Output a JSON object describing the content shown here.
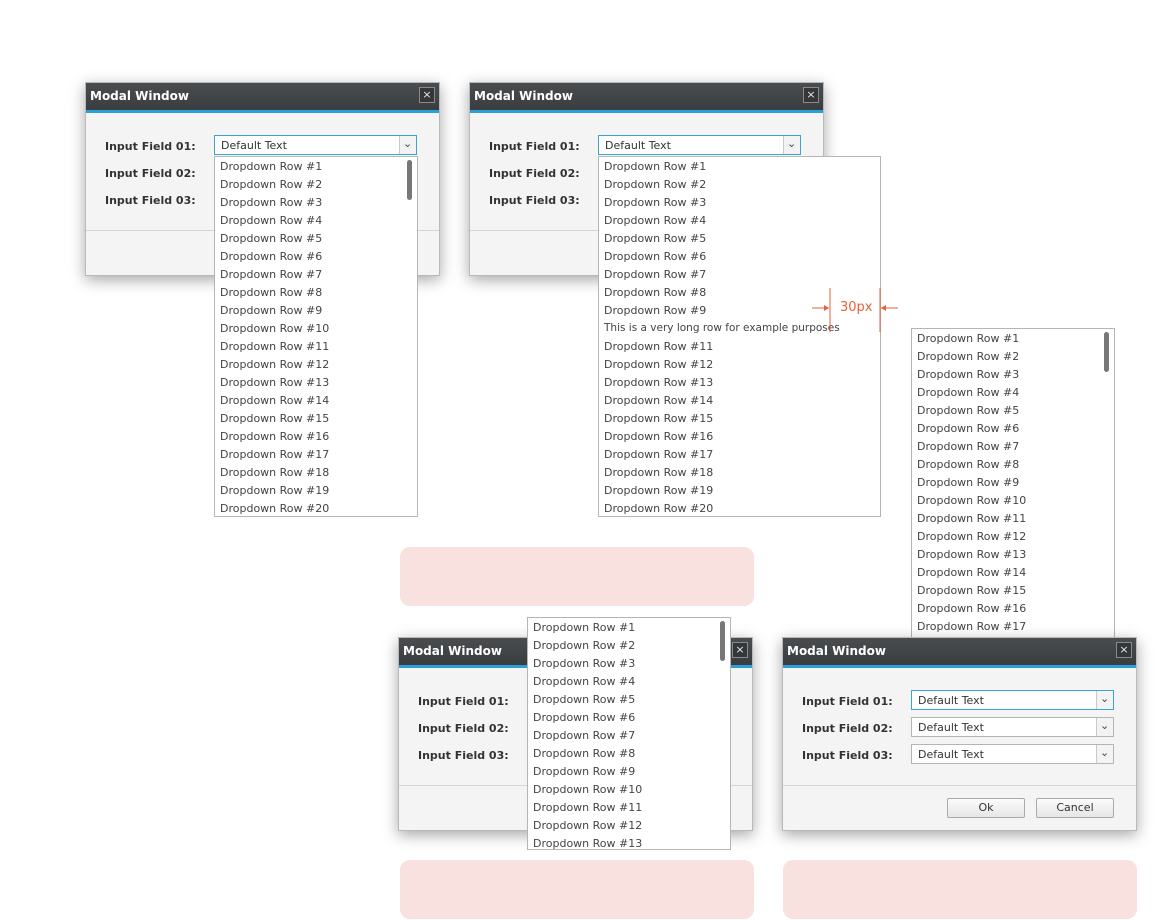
{
  "modal": {
    "title": "Modal Window",
    "close_glyph": "×",
    "labels": [
      "Input Field 01:",
      "Input Field 02:",
      "Input Field 03:"
    ],
    "field_value": "Default Text",
    "ok_label": "Ok",
    "cancel_label": "Cancel"
  },
  "dropdown": {
    "rows": [
      "Dropdown Row #1",
      "Dropdown Row #2",
      "Dropdown Row #3",
      "Dropdown Row #4",
      "Dropdown Row #5",
      "Dropdown Row #6",
      "Dropdown Row #7",
      "Dropdown Row #8",
      "Dropdown Row #9",
      "Dropdown Row #10",
      "Dropdown Row #11",
      "Dropdown Row #12",
      "Dropdown Row #13",
      "Dropdown Row #14",
      "Dropdown Row #15",
      "Dropdown Row #16",
      "Dropdown Row #17",
      "Dropdown Row #18",
      "Dropdown Row #19",
      "Dropdown Row #20"
    ],
    "long_row": "This is a very long row for example purposes"
  },
  "annotation": {
    "spacing_label": "30px",
    "color": "#e8603c"
  },
  "colors": {
    "title_bar": "#3f4245",
    "accent": "#2aa0d6",
    "note_bg": "#f8e1df"
  },
  "icons": {
    "dropdown_arrow": "chevron-down-icon",
    "close": "close-icon"
  }
}
